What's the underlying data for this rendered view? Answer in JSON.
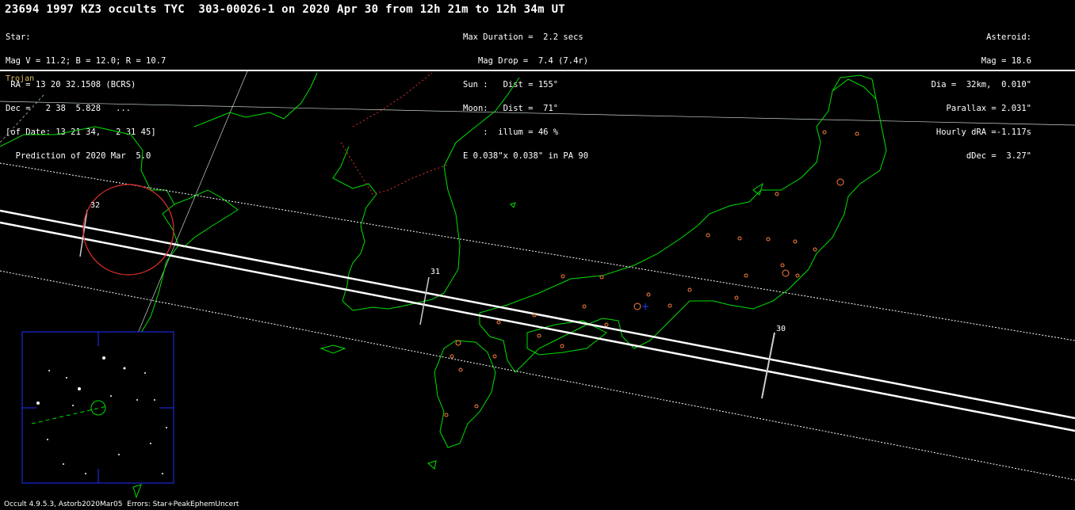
{
  "header": {
    "title": "23694 1997 KZ3 occults TYC  303-00026-1 on 2020 Apr 30 from 12h 21m to 12h 34m UT"
  },
  "star": [
    "Star:",
    "Mag V = 11.2; B = 12.0; R = 10.7",
    " RA = 13 20 32.1508 (BCRS)",
    "Dec =   2 38  5.828   ...",
    "[of Date: 13 21 34,   2 31 45]",
    "  Prediction of 2020 Mar  5.0"
  ],
  "event": [
    "Max Duration =  2.2 secs",
    "   Mag Drop =  7.4 (7.4r)",
    "Sun :   Dist = 155°",
    "Moon:   Dist =  71°",
    "    :  illum = 46 %",
    "E 0.038\"x 0.038\" in PA 90"
  ],
  "asteroid": [
    "Asteroid:",
    "Mag = 18.6",
    "Dia =  32km,  0.010\"",
    "Parallax = 2.031\"",
    "Hourly dRA =-1.117s",
    "dDec =  3.27\""
  ],
  "class_label": "Trojan",
  "footer": "Occult 4.9.5.3, Astorb2020Mar05  Errors: Star+PeakEphemUncert",
  "path_labels": [
    "32",
    "31",
    "30"
  ],
  "colors": {
    "coast": "#00e000",
    "border": "#e03030",
    "path": "#ffffff",
    "sites": "#ff8040",
    "inset": "#2030ff",
    "trojan": "#e0c060"
  }
}
